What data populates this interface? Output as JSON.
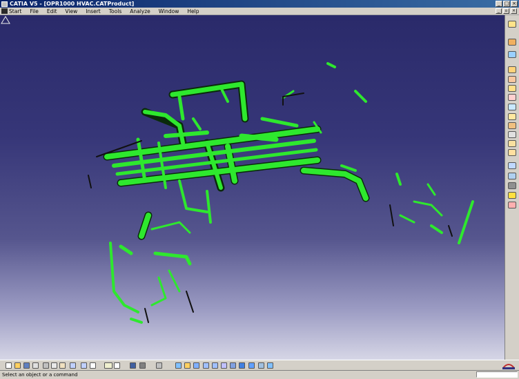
{
  "window": {
    "title": "CATIA V5 - [OPR1000 HVAC.CATProduct]"
  },
  "menu": {
    "items": [
      "Start",
      "File",
      "Edit",
      "View",
      "Insert",
      "Tools",
      "Analyze",
      "Window",
      "Help"
    ]
  },
  "status": {
    "message": "Select an object or a command",
    "command_input": ""
  },
  "colors": {
    "model": "#2ee82e",
    "background_top": "#2a2a6a",
    "background_bottom": "#d6d6e6"
  },
  "right_toolbar_icons": [
    "select-icon",
    "fly-icon",
    "product-icon",
    "component-icon",
    "part-icon",
    "insert-component-icon",
    "replace-icon",
    "graph-icon",
    "renumber-icon",
    "bill-of-material-icon",
    "clash-icon",
    "compare-icon",
    "constraint-icon",
    "manipulate-icon",
    "snap-icon",
    "explode-icon",
    "light-icon",
    "delete-icon"
  ],
  "bottom_toolbar_icons": [
    "new-icon",
    "open-icon",
    "save-icon",
    "print-icon",
    "cut-icon",
    "copy-icon",
    "paste-icon",
    "undo-icon",
    "redo-icon",
    "whats-this-icon",
    "formula-icon",
    "comment-icon",
    "catalog-icon",
    "measure-icon",
    "fly-mode-icon",
    "fit-all-icon",
    "pan-icon",
    "rotate-icon",
    "zoom-in-icon",
    "zoom-out-icon",
    "normal-view-icon",
    "iso-view-icon",
    "views-icon",
    "render-style-icon",
    "hide-show-icon",
    "swap-space-icon"
  ]
}
